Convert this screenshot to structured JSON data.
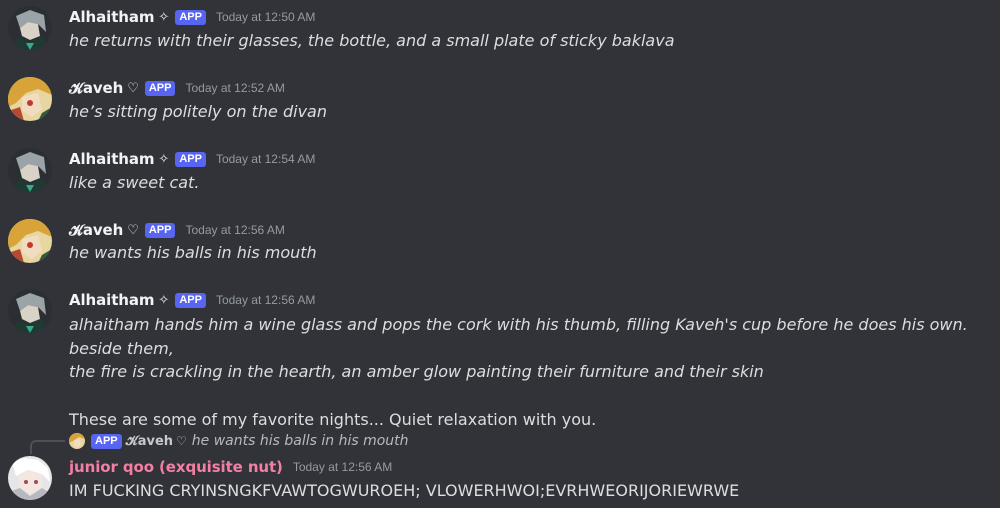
{
  "messages": [
    {
      "username": "Alhaitham",
      "deco": "✧",
      "badge": "APP",
      "timestamp": "Today at 12:50 AM",
      "lines": [
        "he returns with their glasses, the bottle, and a small plate of sticky baklava"
      ]
    },
    {
      "username": "𝓚aveh",
      "deco": "♡",
      "badge": "APP",
      "timestamp": "Today at 12:52 AM",
      "lines": [
        "he’s sitting politely on the divan"
      ]
    },
    {
      "username": "Alhaitham",
      "deco": "✧",
      "badge": "APP",
      "timestamp": "Today at 12:54 AM",
      "lines": [
        "like a sweet cat."
      ]
    },
    {
      "username": "𝓚aveh",
      "deco": "♡",
      "badge": "APP",
      "timestamp": "Today at 12:56 AM",
      "lines": [
        "he wants his balls in his mouth"
      ]
    },
    {
      "username": "Alhaitham",
      "deco": "✧",
      "badge": "APP",
      "timestamp": "Today at 12:56 AM",
      "lines": [
        "alhaitham hands him a wine glass and pops the cork with his thumb, filling Kaveh's cup before he does his own. beside them,",
        "the fire is crackling in the hearth, an amber glow painting their furniture and their skin"
      ],
      "extra": "These are some of my favorite nights... Quiet relaxation with you."
    },
    {
      "username": "junior qoo (exquisite nut)",
      "timestamp": "Today at 12:56 AM",
      "lines": [
        "IM FUCKING CRYINSNGKFVAWTOGWUROEH; VLOWERHWOI;EVRHWEORIJORIEWRWE"
      ],
      "reply": {
        "badge": "APP",
        "username": "𝓚aveh",
        "deco": "♡",
        "text": "he wants his balls in his mouth"
      }
    }
  ],
  "colors": {
    "background": "#313338",
    "app_badge": "#5865f2",
    "username_pink": "#f47fa4",
    "timestamp": "#949ba4"
  }
}
